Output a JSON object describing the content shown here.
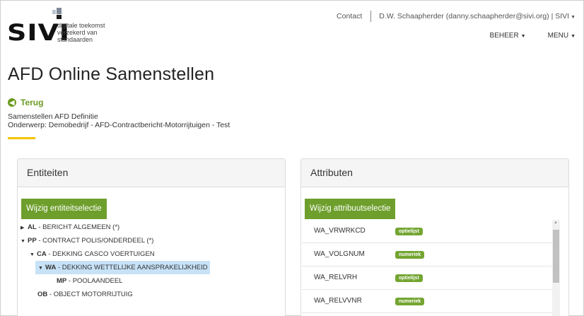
{
  "brand": {
    "name": "SIVI",
    "tagline": [
      "digitale toekomst",
      "verzekerd van",
      "standaarden"
    ],
    "colors": {
      "dark": "#1b1b1b",
      "mid": "#7f8a99",
      "light": "#b9c3cf"
    }
  },
  "topnav": {
    "contact": "Contact",
    "user": "D.W. Schaapherder (danny.schaapherder@sivi.org) | SIVI"
  },
  "menunav": {
    "beheer": "BEHEER",
    "menu": "MENU"
  },
  "page": {
    "title": "AFD Online Samenstellen",
    "back_label": "Terug",
    "subtitle_line1": "Samenstellen AFD Definitie",
    "subtitle_line2": "Onderwerp: Demobedrijf - AFD-Contractbericht-Motorrijtuigen - Test"
  },
  "colors": {
    "accent_green": "#6e9f2c",
    "accent_yellow": "#f4c400",
    "selection": "#c7e2f7"
  },
  "entiteiten": {
    "title": "Entiteiten",
    "button": "Wijzig entiteitselectie",
    "items": [
      {
        "code": "AL",
        "label": " - BERICHT ALGEMEEN (*)",
        "arrow": "▶"
      },
      {
        "code": "PP",
        "label": " - CONTRACT POLIS/ONDERDEEL (*)",
        "arrow": "▼"
      },
      {
        "code": "CA",
        "label": " - DEKKING CASCO VOERTUIGEN",
        "arrow": "▼"
      },
      {
        "code": "WA",
        "label": " - DEKKING WETTELIJKE AANSPRAKELIJKHEID",
        "arrow": "▼"
      },
      {
        "code": "MP",
        "label": " - POOLAANDEEL",
        "arrow": ""
      },
      {
        "code": "OB",
        "label": " - OBJECT MOTORRIJTUIG",
        "arrow": ""
      }
    ]
  },
  "attributen": {
    "title": "Attributen",
    "button": "Wijzig attribuutselectie",
    "items": [
      {
        "name": "WA_VRWRKCD",
        "type": "optielijst"
      },
      {
        "name": "WA_VOLGNUM",
        "type": "numeriek"
      },
      {
        "name": "WA_RELVRH",
        "type": "optielijst"
      },
      {
        "name": "WA_RELVVNR",
        "type": "numeriek"
      }
    ]
  }
}
